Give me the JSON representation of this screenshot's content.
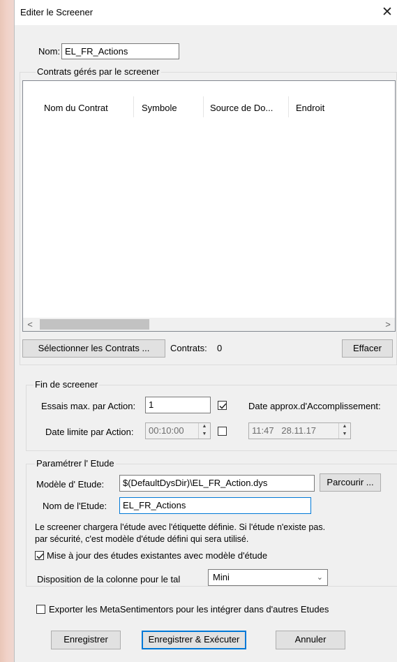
{
  "dialog": {
    "title": "Editer le Screener",
    "close_symbol": "✕"
  },
  "name": {
    "label": "Nom:",
    "value": "EL_FR_Actions"
  },
  "contracts": {
    "group_label": "Contrats gérés par le screener",
    "columns": [
      "Nom du Contrat",
      "Symbole",
      "Source de Do...",
      "Endroit"
    ],
    "rows": [],
    "select_button": "Sélectionner les Contrats ...",
    "count_label": "Contrats:",
    "count_value": "0",
    "clear_button": "Effacer"
  },
  "end": {
    "group_label": "Fin de screener",
    "max_tries_label": "Essais max. par Action:",
    "max_tries_value": "1",
    "max_tries_checked": true,
    "approx_date_label": "Date approx.d'Accomplissement:",
    "deadline_label": "Date limite par Action:",
    "deadline_value": "00:10:00",
    "deadline_checked": false,
    "date_value": "11:47   28.11.17"
  },
  "study": {
    "group_label": "Paramétrer l' Etude",
    "model_label": "Modèle d' Etude:",
    "model_value": "$(DefaultDysDir)\\EL_FR_Action.dys",
    "browse_button": "Parcourir ...",
    "name_label": "Nom de l'Etude:",
    "name_value": "EL_FR_Actions",
    "info_line1": "Le screener chargera l'étude avec l'étiquette définie. Si l'étude n'existe pas.",
    "info_line2": "par sécurité, c'est modèle d'étude défini qui sera utilisé.",
    "update_label": "Mise à jour des études existantes avec modèle d'étude",
    "update_checked": true,
    "layout_label": "Disposition de la colonne pour le tal",
    "layout_value": "Mini"
  },
  "export": {
    "label": "Exporter les MetaSentimentors pour les intégrer dans d'autres Etudes",
    "checked": false
  },
  "buttons": {
    "save": "Enregistrer",
    "save_run": "Enregistrer & Exécuter",
    "cancel": "Annuler"
  }
}
